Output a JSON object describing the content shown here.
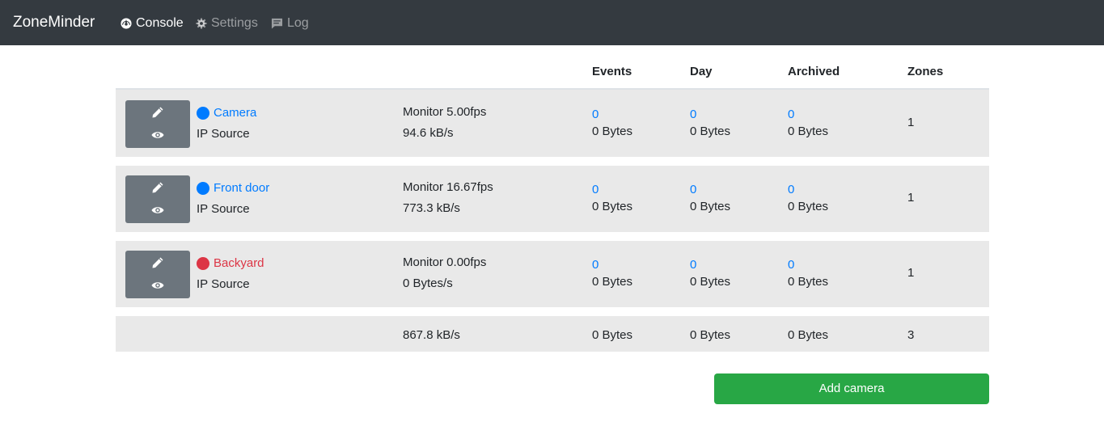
{
  "navbar": {
    "brand": "ZoneMinder",
    "items": [
      {
        "label": "Console",
        "icon": "dashboard-icon",
        "active": true
      },
      {
        "label": "Settings",
        "icon": "gear-icon",
        "active": false
      },
      {
        "label": "Log",
        "icon": "message-icon",
        "active": false
      }
    ]
  },
  "table": {
    "headers": [
      "Events",
      "Day",
      "Archived",
      "Zones"
    ],
    "rows": [
      {
        "name": "Camera",
        "status_color": "#007bff",
        "source": "IP Source",
        "fps": "Monitor 5.00fps",
        "bandwidth": "94.6 kB/s",
        "events_count": "0",
        "events_size": "0 Bytes",
        "day_count": "0",
        "day_size": "0 Bytes",
        "archived_count": "0",
        "archived_size": "0 Bytes",
        "zones": "1"
      },
      {
        "name": "Front door",
        "status_color": "#007bff",
        "source": "IP Source",
        "fps": "Monitor 16.67fps",
        "bandwidth": "773.3 kB/s",
        "events_count": "0",
        "events_size": "0 Bytes",
        "day_count": "0",
        "day_size": "0 Bytes",
        "archived_count": "0",
        "archived_size": "0 Bytes",
        "zones": "1"
      },
      {
        "name": "Backyard",
        "status_color": "#dc3545",
        "source": "IP Source",
        "fps": "Monitor 0.00fps",
        "bandwidth": "0 Bytes/s",
        "events_count": "0",
        "events_size": "0 Bytes",
        "day_count": "0",
        "day_size": "0 Bytes",
        "archived_count": "0",
        "archived_size": "0 Bytes",
        "zones": "1"
      }
    ],
    "totals": {
      "bandwidth": "867.8 kB/s",
      "events_size": "0 Bytes",
      "day_size": "0 Bytes",
      "archived_size": "0 Bytes",
      "zones": "3"
    }
  },
  "add_camera_label": "Add camera",
  "colors": {
    "navbar": "#343a40",
    "link": "#007bff",
    "danger": "#dc3545",
    "success": "#28a745",
    "row": "#e9e9e9",
    "action": "#6c757d"
  }
}
